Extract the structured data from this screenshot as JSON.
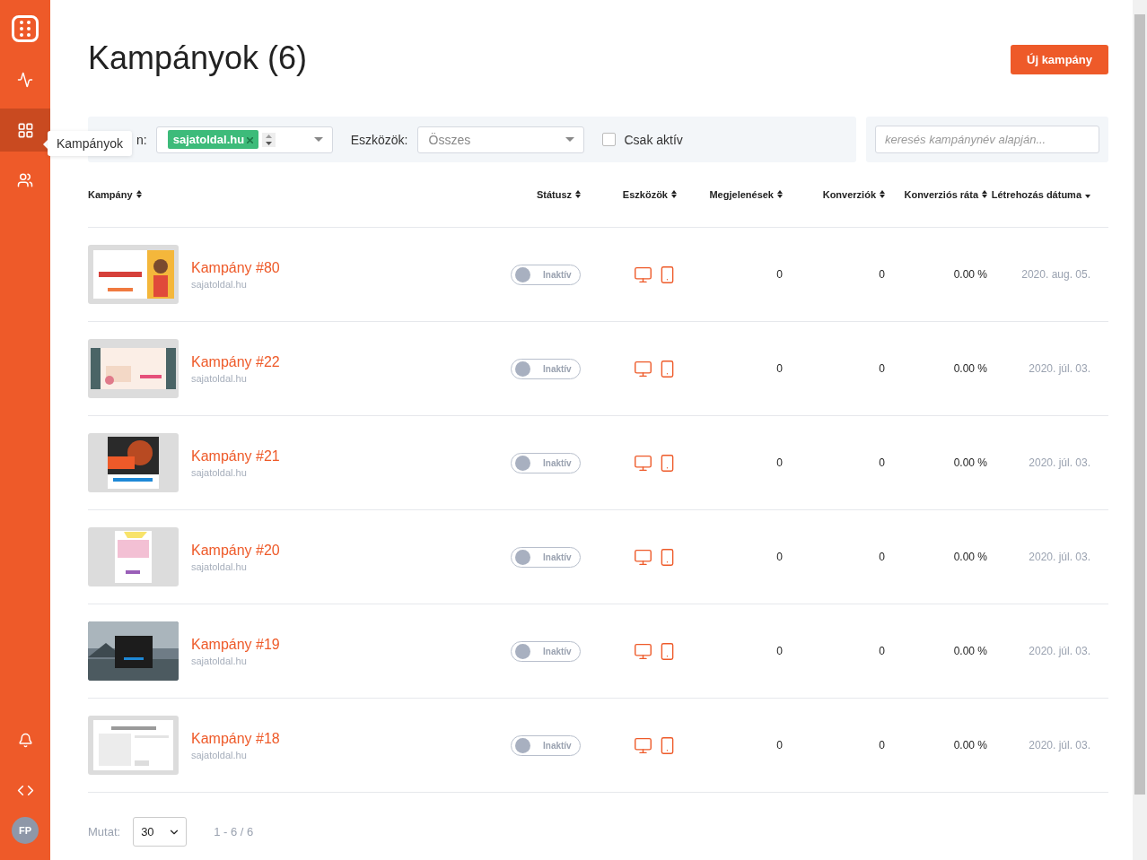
{
  "sidebar": {
    "items": [
      {
        "selected": false
      },
      {
        "selected": true
      },
      {
        "selected": false
      }
    ],
    "avatar": "FP",
    "tooltip": "Kampányok"
  },
  "header": {
    "title": "Kampányok (6)",
    "new_button": "Új kampány"
  },
  "filters": {
    "domain_label": "n:",
    "domain_tag": "sajatoldal.hu",
    "devices_label": "Eszközök:",
    "devices_value": "Összes",
    "only_active": {
      "label": "Csak aktív",
      "checked": false
    },
    "search": {
      "placeholder": "keresés kampánynév alapján..."
    }
  },
  "table": {
    "columns": [
      {
        "label": "Kampány",
        "sorted": false
      },
      {
        "label": "Státusz",
        "sorted": false
      },
      {
        "label": "Eszközök",
        "sorted": false
      },
      {
        "label": "Megjelenések",
        "sorted": false
      },
      {
        "label": "Konverziók",
        "sorted": false
      },
      {
        "label": "Konverziós ráta",
        "sorted": false
      },
      {
        "label": "Létrehozás dátuma",
        "sorted": true
      }
    ],
    "rows": [
      {
        "name": "Kampány #80",
        "domain": "sajatoldal.hu",
        "status": {
          "label": "Inaktív",
          "on": false
        },
        "impressions": "0",
        "conversions": "0",
        "rate": "0.00 %",
        "created": "2020. aug. 05."
      },
      {
        "name": "Kampány #22",
        "domain": "sajatoldal.hu",
        "status": {
          "label": "Inaktív",
          "on": false
        },
        "impressions": "0",
        "conversions": "0",
        "rate": "0.00 %",
        "created": "2020. júl. 03."
      },
      {
        "name": "Kampány #21",
        "domain": "sajatoldal.hu",
        "status": {
          "label": "Inaktív",
          "on": false
        },
        "impressions": "0",
        "conversions": "0",
        "rate": "0.00 %",
        "created": "2020. júl. 03."
      },
      {
        "name": "Kampány #20",
        "domain": "sajatoldal.hu",
        "status": {
          "label": "Inaktív",
          "on": false
        },
        "impressions": "0",
        "conversions": "0",
        "rate": "0.00 %",
        "created": "2020. júl. 03."
      },
      {
        "name": "Kampány #19",
        "domain": "sajatoldal.hu",
        "status": {
          "label": "Inaktív",
          "on": false
        },
        "impressions": "0",
        "conversions": "0",
        "rate": "0.00 %",
        "created": "2020. júl. 03."
      },
      {
        "name": "Kampány #18",
        "domain": "sajatoldal.hu",
        "status": {
          "label": "Inaktív",
          "on": false
        },
        "impressions": "0",
        "conversions": "0",
        "rate": "0.00 %",
        "created": "2020. júl. 03."
      }
    ]
  },
  "pagination": {
    "label": "Mutat:",
    "per_page": "30",
    "range": "1 - 6 / 6"
  }
}
